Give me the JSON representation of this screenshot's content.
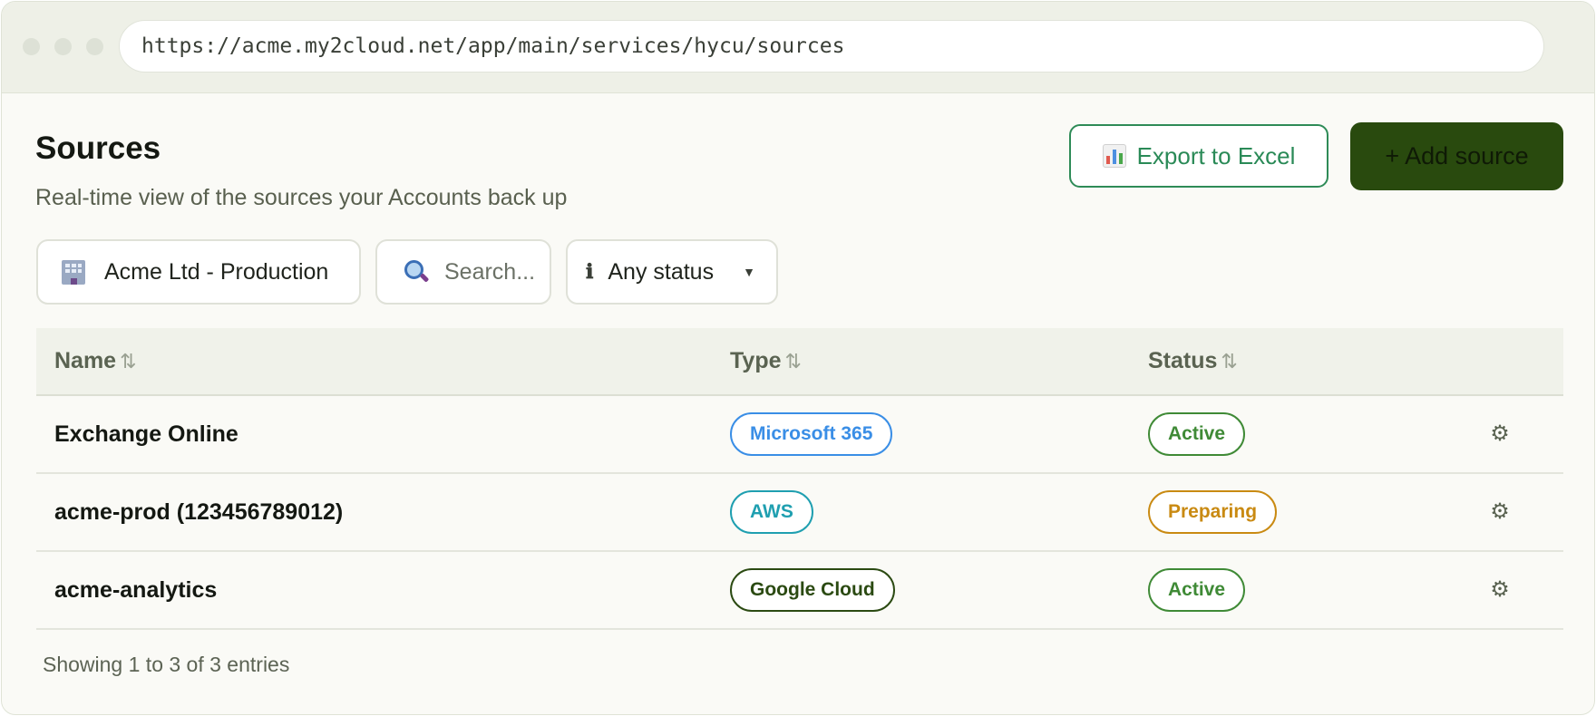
{
  "browser": {
    "url": "https://acme.my2cloud.net/app/main/services/hycu/sources"
  },
  "header": {
    "title": "Sources",
    "subtitle": "Real-time view of the sources your Accounts back up",
    "export_label": "Export to Excel",
    "add_label": "+ Add source"
  },
  "filters": {
    "organization": "Acme Ltd - Production",
    "search_placeholder": "Search...",
    "status": "Any status",
    "status_icon": "ℹ",
    "caret": "▼"
  },
  "table": {
    "columns": [
      {
        "label": "Name",
        "sort_icon": "⇅"
      },
      {
        "label": "Type",
        "sort_icon": "⇅"
      },
      {
        "label": "Status",
        "sort_icon": "⇅"
      }
    ],
    "rows": [
      {
        "name": "Exchange Online",
        "type": "Microsoft 365",
        "status": "Active",
        "action_icon": "⚙"
      },
      {
        "name": "acme-prod (123456789012)",
        "type": "AWS",
        "status": "Preparing",
        "action_icon": "⚙"
      },
      {
        "name": "acme-analytics",
        "type": "Google Cloud",
        "status": "Active",
        "action_icon": "⚙"
      }
    ]
  },
  "footer": {
    "entries_text": "Showing 1 to 3 of 3 entries"
  },
  "colors": {
    "accent_green": "#2a8a57",
    "primary_button_bg": "#294a0e",
    "type_microsoft": "#3a8ee6",
    "type_aws": "#1f9fb0",
    "type_google": "#2b4a12",
    "status_active": "#3f8a36",
    "status_preparing": "#c98a12"
  },
  "icons": {
    "export": "excel-chart-icon",
    "organization": "building-icon",
    "search": "magnifier-icon",
    "status_filter": "info-icon",
    "row_action": "gear-icon"
  }
}
